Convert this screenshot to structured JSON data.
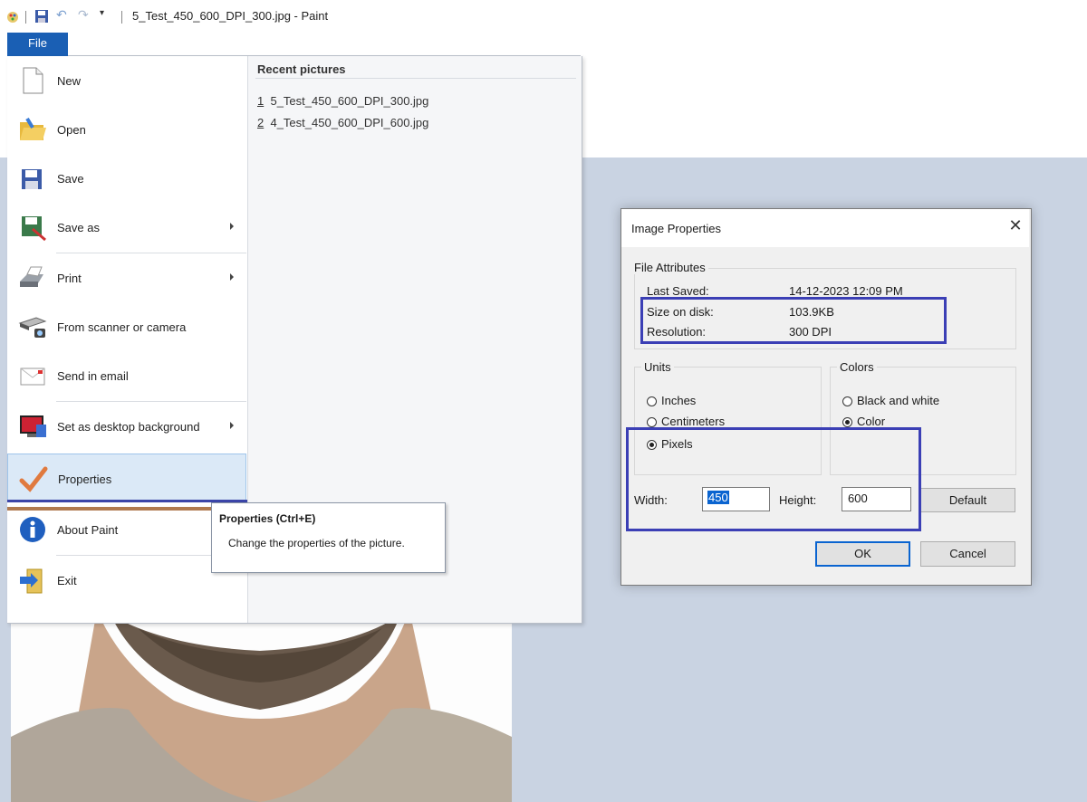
{
  "app": {
    "window_title": "5_Test_450_600_DPI_300.jpg - Paint"
  },
  "file_tab": {
    "label": "File"
  },
  "file_menu": {
    "items": [
      {
        "label": "New",
        "icon": "new-document-icon",
        "submenu": false
      },
      {
        "label": "Open",
        "icon": "open-folder-icon",
        "submenu": false
      },
      {
        "label": "Save",
        "icon": "floppy-disk-icon",
        "submenu": false
      },
      {
        "label": "Save as",
        "icon": "save-as-icon",
        "submenu": true
      },
      {
        "label": "Print",
        "icon": "printer-icon",
        "submenu": true
      },
      {
        "label": "From scanner or camera",
        "icon": "scanner-icon",
        "submenu": false
      },
      {
        "label": "Send in email",
        "icon": "email-icon",
        "submenu": false
      },
      {
        "label": "Set as desktop background",
        "icon": "desktop-background-icon",
        "submenu": true
      },
      {
        "label": "Properties",
        "icon": "checkmark-icon",
        "submenu": false,
        "selected": true
      },
      {
        "label": "About Paint",
        "icon": "info-icon",
        "submenu": false
      },
      {
        "label": "Exit",
        "icon": "exit-icon",
        "submenu": false
      }
    ],
    "recent_title": "Recent pictures",
    "recent": [
      {
        "index": "1",
        "name": "5_Test_450_600_DPI_300.jpg"
      },
      {
        "index": "2",
        "name": "4_Test_450_600_DPI_600.jpg"
      }
    ]
  },
  "tooltip": {
    "title": "Properties (Ctrl+E)",
    "description": "Change the properties of the picture."
  },
  "dialog": {
    "title": "Image Properties",
    "file_attributes": {
      "legend": "File Attributes",
      "last_saved_label": "Last Saved:",
      "last_saved_value": "14-12-2023 12:09 PM",
      "size_label": "Size on disk:",
      "size_value": "103.9KB",
      "resolution_label": "Resolution:",
      "resolution_value": "300 DPI"
    },
    "units": {
      "legend": "Units",
      "options": [
        "Inches",
        "Centimeters",
        "Pixels"
      ],
      "selected": "Pixels"
    },
    "colors": {
      "legend": "Colors",
      "options": [
        "Black and white",
        "Color"
      ],
      "selected": "Color"
    },
    "width_label": "Width:",
    "width_value": "450",
    "height_label": "Height:",
    "height_value": "600",
    "default_button": "Default",
    "ok_button": "OK",
    "cancel_button": "Cancel"
  },
  "colors": {
    "file_tab": "#1a5fb4",
    "highlight_box": "#3b3fb5",
    "workspace": "#c9d3e2"
  }
}
